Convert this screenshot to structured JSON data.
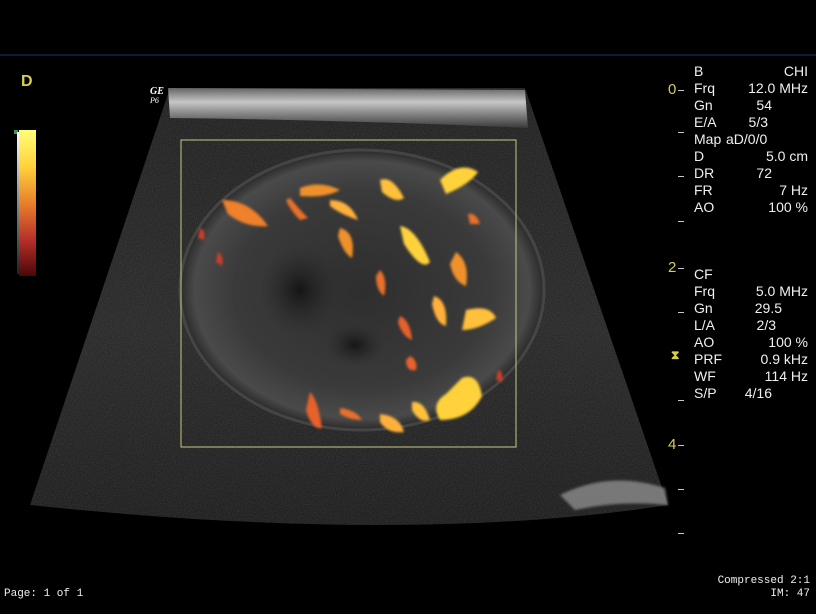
{
  "mode_letter": "D",
  "probe_logo": {
    "brand": "GE",
    "sub": "P6"
  },
  "colors": {
    "accent_yellow": "#d8cf4a",
    "text_white": "#f0f0f0",
    "frame_color": "#c8c880",
    "doppler_hot": "#ffd23a",
    "doppler_mid": "#e8802a",
    "doppler_low": "#b8302a"
  },
  "depth_scale": {
    "labels": [
      "0",
      "2",
      "4"
    ],
    "unit_note": ""
  },
  "focus_marker": "⧗",
  "b_mode": [
    {
      "key": "B",
      "value": "CHI"
    },
    {
      "key": "Frq",
      "value": "12.0 MHz"
    },
    {
      "key": "Gn",
      "value": "54"
    },
    {
      "key": "E/A",
      "value": "5/3"
    },
    {
      "key": "Map",
      "value": "aD/0/0"
    },
    {
      "key": "D",
      "value": "5.0 cm"
    },
    {
      "key": "DR",
      "value": "72"
    },
    {
      "key": "FR",
      "value": "7 Hz"
    },
    {
      "key": "AO",
      "value": "100 %"
    }
  ],
  "color_flow": [
    {
      "key": "CF",
      "value": ""
    },
    {
      "key": "Frq",
      "value": "5.0 MHz"
    },
    {
      "key": "Gn",
      "value": "29.5"
    },
    {
      "key": "L/A",
      "value": "2/3"
    },
    {
      "key": "AO",
      "value": "100 %"
    },
    {
      "key": "PRF",
      "value": "0.9 kHz"
    },
    {
      "key": "WF",
      "value": "114 Hz"
    },
    {
      "key": "S/P",
      "value": "4/16"
    }
  ],
  "footer": {
    "page": "Page: 1 of 1",
    "compression": "Compressed 2:1",
    "image_number": "IM: 47"
  }
}
